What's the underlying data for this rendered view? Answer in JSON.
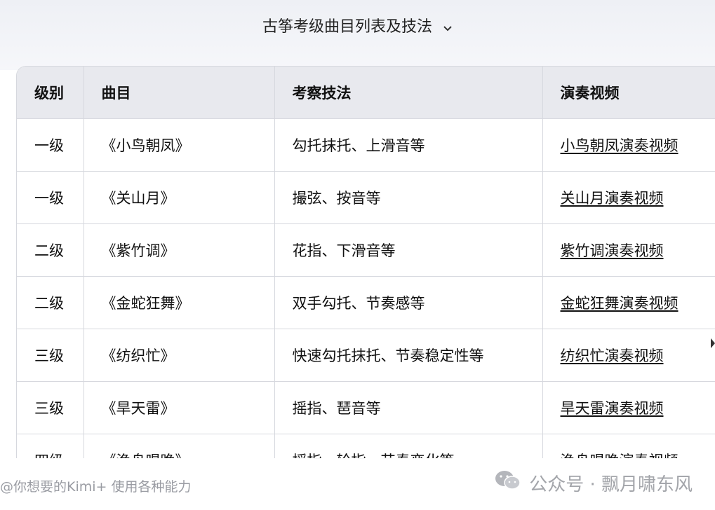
{
  "header": {
    "title": "古筝考级曲目列表及技法"
  },
  "table": {
    "columns": [
      "级别",
      "曲目",
      "考察技法",
      "演奏视频"
    ],
    "rows": [
      {
        "level": "一级",
        "piece": "《小鸟朝凤》",
        "technique": "勾托抹托、上滑音等",
        "video": "小鸟朝凤演奏视频"
      },
      {
        "level": "一级",
        "piece": "《关山月》",
        "technique": "撮弦、按音等",
        "video": "关山月演奏视频"
      },
      {
        "level": "二级",
        "piece": "《紫竹调》",
        "technique": "花指、下滑音等",
        "video": "紫竹调演奏视频"
      },
      {
        "level": "二级",
        "piece": "《金蛇狂舞》",
        "technique": "双手勾托、节奏感等",
        "video": "金蛇狂舞演奏视频"
      },
      {
        "level": "三级",
        "piece": "《纺织忙》",
        "technique": "快速勾托抹托、节奏稳定性等",
        "video": "纺织忙演奏视频"
      },
      {
        "level": "三级",
        "piece": "《旱天雷》",
        "technique": "摇指、琶音等",
        "video": "旱天雷演奏视频"
      },
      {
        "level": "四级",
        "piece": "《渔舟唱晚》",
        "technique": "摇指、轮指、节奏变化等",
        "video": "渔舟唱晚演奏视频"
      }
    ]
  },
  "footer": {
    "left_text": "@你想要的Kimi+ 使用各种能力",
    "right_text": "公众号 · 飘月啸东风"
  },
  "icons": {
    "title_toggle": "chevron-down-icon",
    "watermark": "wechat-icon",
    "edge": "caret-right-icon"
  }
}
